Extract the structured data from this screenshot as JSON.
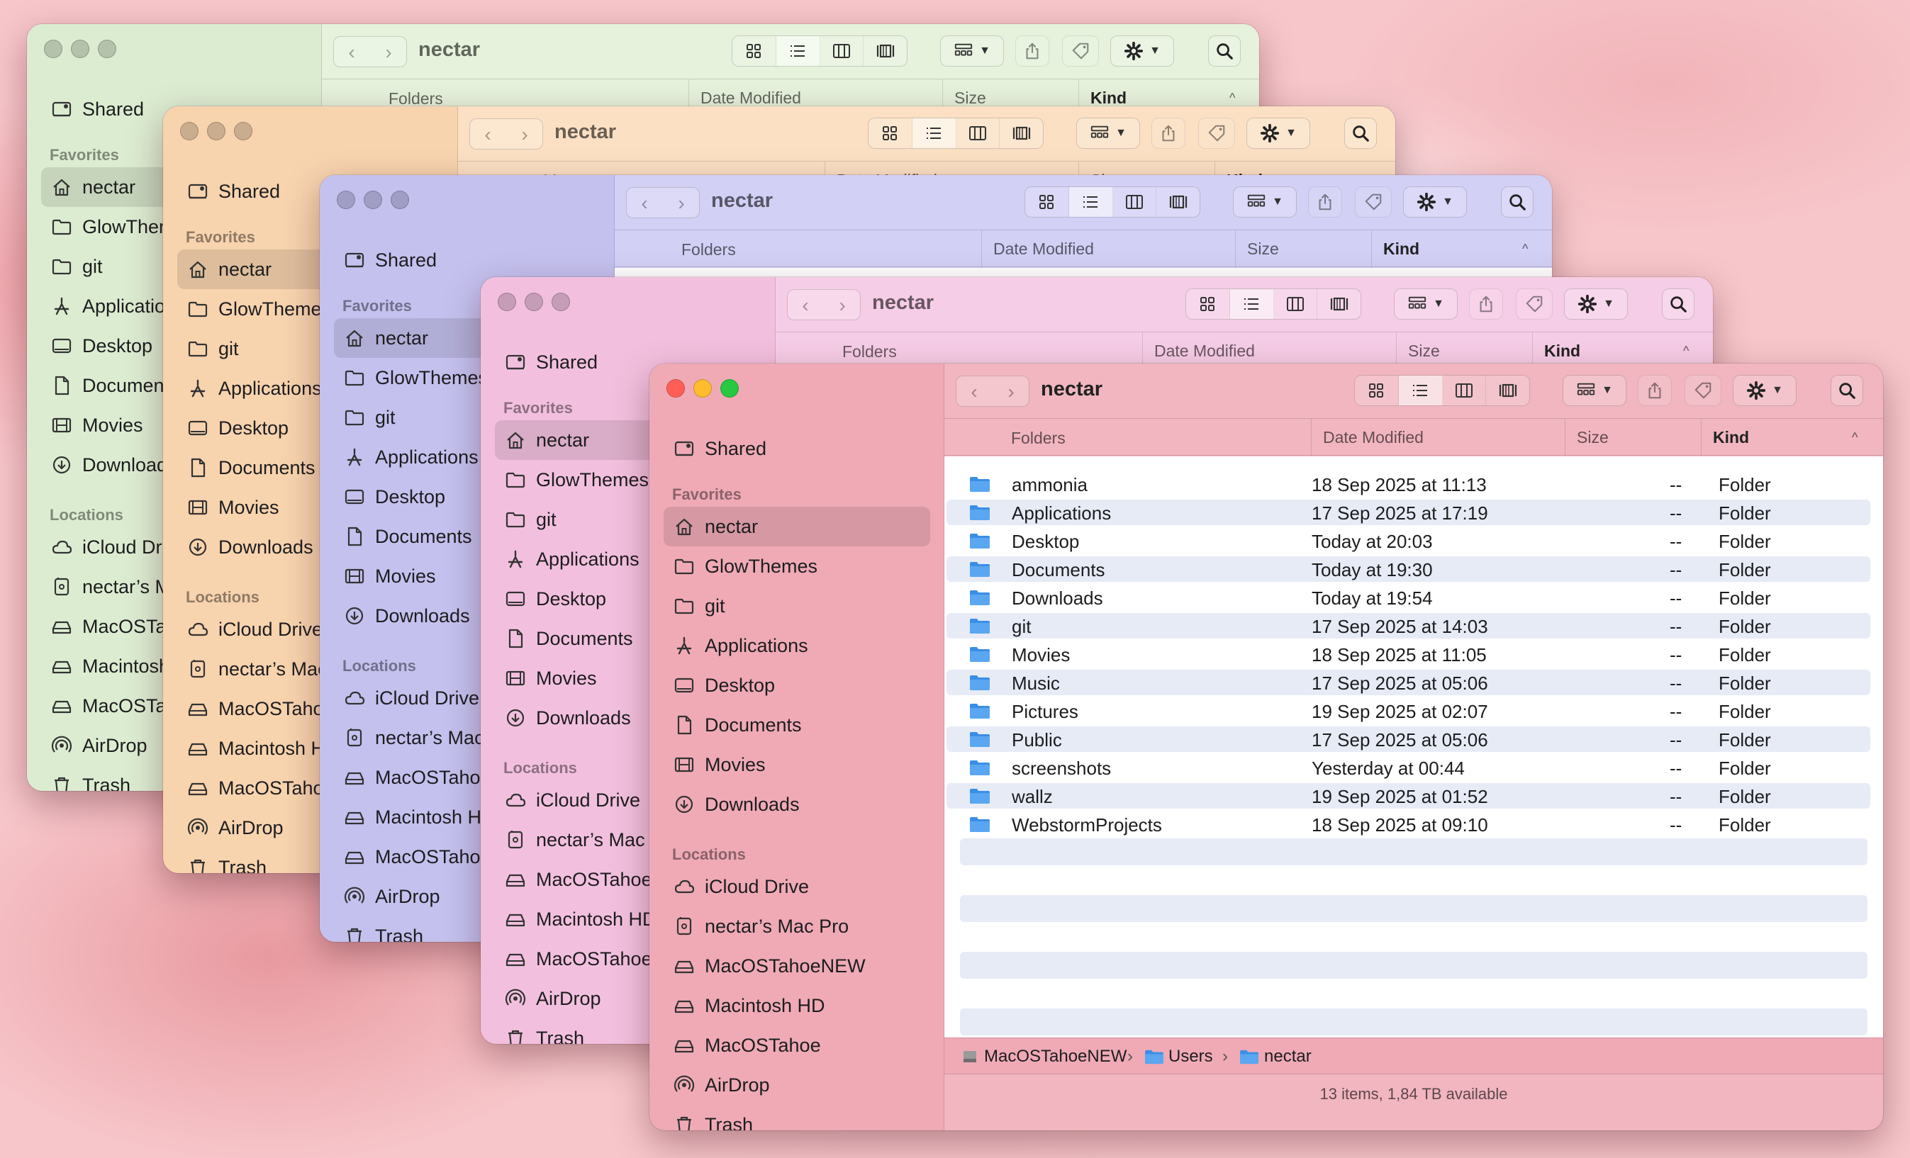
{
  "windows": [
    {
      "id": "green",
      "bg": "#e6f2dc",
      "sidebar_bg": "#dcecd1",
      "title": "nectar"
    },
    {
      "id": "orange",
      "bg": "#fbe0c4",
      "sidebar_bg": "#f7d3ae",
      "title": "nectar"
    },
    {
      "id": "blue",
      "bg": "#d2d0f5",
      "sidebar_bg": "#c4c1ef",
      "title": "nectar"
    },
    {
      "id": "pink",
      "bg": "#f6cde6",
      "sidebar_bg": "#f2c0de",
      "title": "nectar"
    },
    {
      "id": "red",
      "bg": "#f1b6c0",
      "sidebar_bg": "#efaab6",
      "title": "nectar"
    }
  ],
  "sidebar": {
    "shared": "Shared",
    "favorites_heading": "Favorites",
    "favorites": [
      "nectar",
      "GlowThemes",
      "git",
      "Applications",
      "Desktop",
      "Documents",
      "Movies",
      "Downloads"
    ],
    "locations_heading": "Locations",
    "locations": [
      "iCloud Drive",
      "nectar’s Mac Pro",
      "MacOSTahoeNEW",
      "Macintosh HD",
      "MacOSTahoe",
      "AirDrop",
      "Trash"
    ]
  },
  "toolbar": {
    "title": "nectar",
    "back": "‹",
    "forward": "›"
  },
  "columns": {
    "name": "Folders",
    "date": "Date Modified",
    "size": "Size",
    "kind": "Kind"
  },
  "files": [
    {
      "name": "ammonia",
      "date": "18 Sep 2025 at 11:13",
      "size": "--",
      "kind": "Folder"
    },
    {
      "name": "Applications",
      "date": "17 Sep 2025 at 17:19",
      "size": "--",
      "kind": "Folder"
    },
    {
      "name": "Desktop",
      "date": "Today at 20:03",
      "size": "--",
      "kind": "Folder"
    },
    {
      "name": "Documents",
      "date": "Today at 19:30",
      "size": "--",
      "kind": "Folder"
    },
    {
      "name": "Downloads",
      "date": "Today at 19:54",
      "size": "--",
      "kind": "Folder"
    },
    {
      "name": "git",
      "date": "17 Sep 2025 at 14:03",
      "size": "--",
      "kind": "Folder"
    },
    {
      "name": "Movies",
      "date": "18 Sep 2025 at 11:05",
      "size": "--",
      "kind": "Folder"
    },
    {
      "name": "Music",
      "date": "17 Sep 2025 at 05:06",
      "size": "--",
      "kind": "Folder"
    },
    {
      "name": "Pictures",
      "date": "19 Sep 2025 at 02:07",
      "size": "--",
      "kind": "Folder"
    },
    {
      "name": "Public",
      "date": "17 Sep 2025 at 05:06",
      "size": "--",
      "kind": "Folder"
    },
    {
      "name": "screenshots",
      "date": "Yesterday at 00:44",
      "size": "--",
      "kind": "Folder"
    },
    {
      "name": "wallz",
      "date": "19 Sep 2025 at 01:52",
      "size": "--",
      "kind": "Folder"
    },
    {
      "name": "WebstormProjects",
      "date": "18 Sep 2025 at 09:10",
      "size": "--",
      "kind": "Folder"
    }
  ],
  "pathbar": {
    "disk": "MacOSTahoeNEW",
    "users": "Users",
    "home": "nectar",
    "sep": "›"
  },
  "status": "13 items, 1,84 TB available",
  "colors": {
    "folder": "#3a8ee6",
    "accent_red": "#ff5f57",
    "accent_yellow": "#febc2e",
    "accent_green": "#28c840"
  }
}
